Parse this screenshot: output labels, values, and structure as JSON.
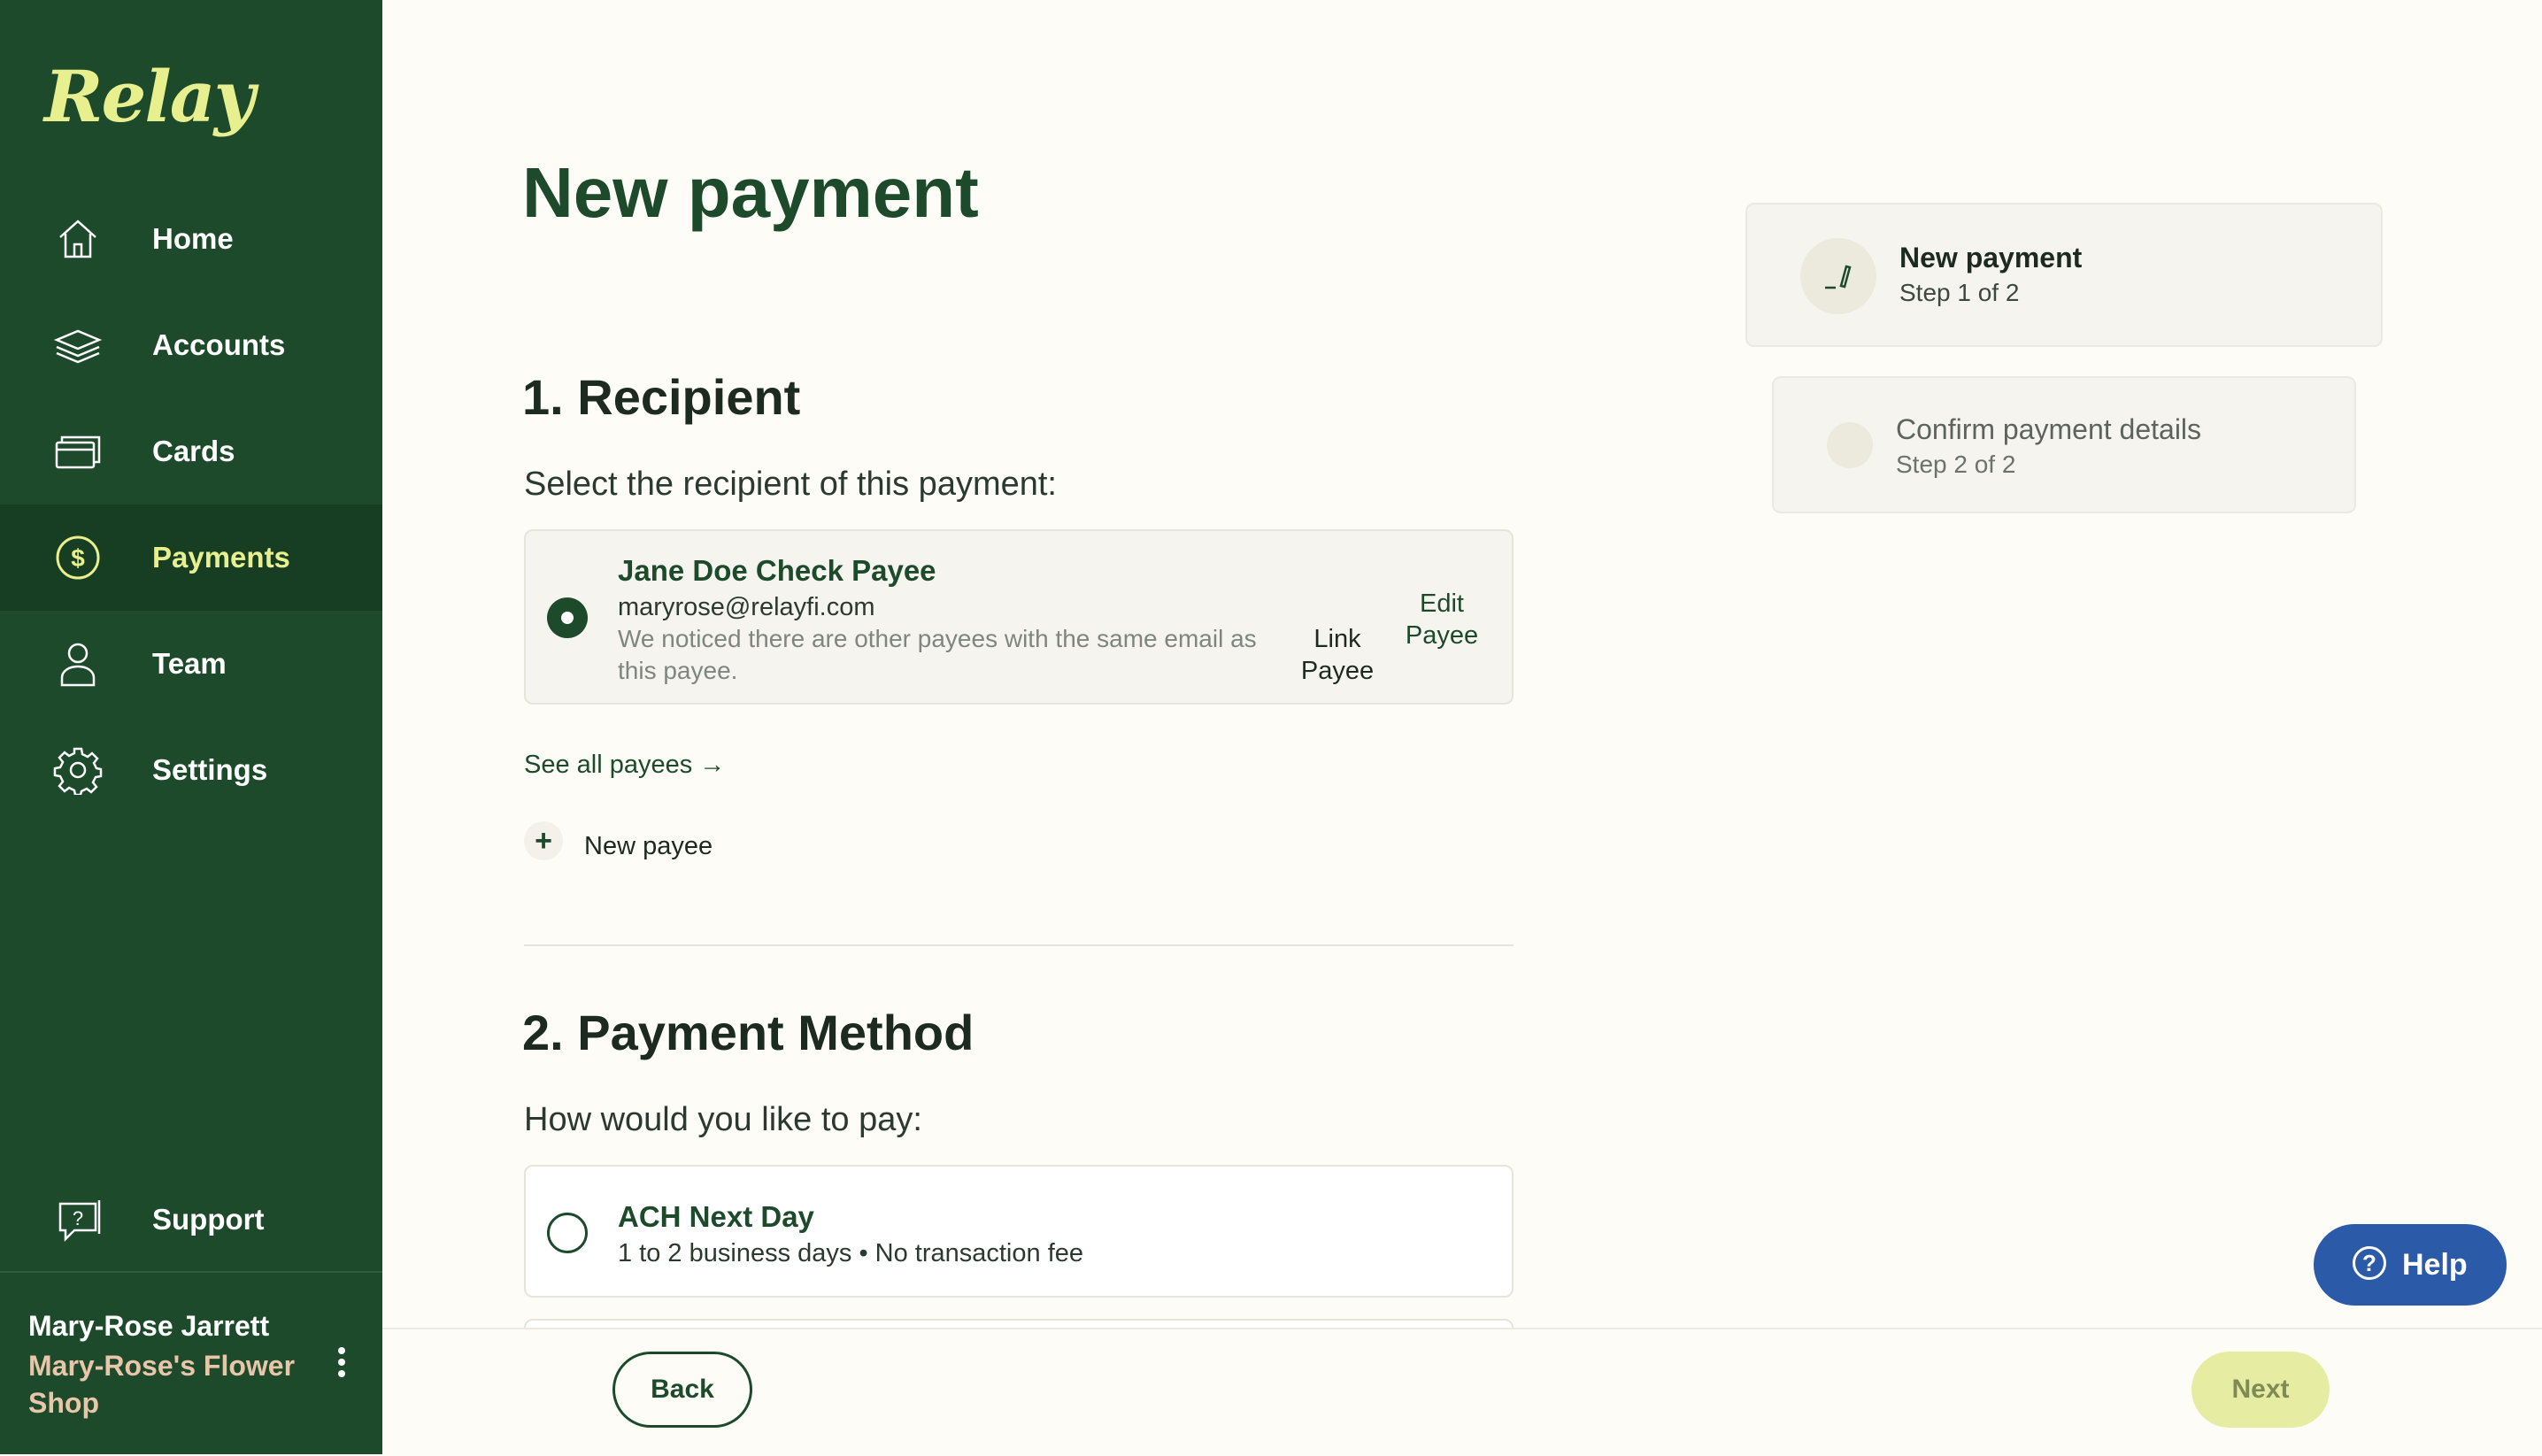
{
  "app": {
    "logo": "Relay"
  },
  "sidebar": {
    "items": [
      {
        "label": "Home",
        "icon": "home-icon"
      },
      {
        "label": "Accounts",
        "icon": "layers-icon"
      },
      {
        "label": "Cards",
        "icon": "cards-icon"
      },
      {
        "label": "Payments",
        "icon": "dollar-icon",
        "active": true
      },
      {
        "label": "Team",
        "icon": "user-icon"
      },
      {
        "label": "Settings",
        "icon": "gear-icon"
      }
    ],
    "support": {
      "label": "Support",
      "icon": "support-icon"
    },
    "user": {
      "name": "Mary-Rose Jarrett",
      "company": "Mary-Rose's Flower Shop"
    }
  },
  "main": {
    "title": "New payment",
    "recipient": {
      "heading": "1. Recipient",
      "prompt": "Select the recipient of this payment:",
      "payee": {
        "name": "Jane Doe Check Payee",
        "email": "maryrose@relayfi.com",
        "note": "We noticed there are other payees with the same email as this payee.",
        "link_action_line1": "Link",
        "link_action_line2": "Payee",
        "edit_action_line1": "Edit",
        "edit_action_line2": "Payee"
      },
      "see_all": "See all payees →",
      "new_payee": "New payee"
    },
    "method": {
      "heading": "2. Payment Method",
      "prompt": "How would you like to pay:",
      "options": [
        {
          "name": "ACH Next Day",
          "desc": "1 to 2 business days • No transaction fee"
        }
      ]
    }
  },
  "steps": [
    {
      "title": "New payment",
      "sub": "Step 1 of 2",
      "icon": "pencil-icon"
    },
    {
      "title": "Confirm payment details",
      "sub": "Step 2 of 2"
    }
  ],
  "footer": {
    "back": "Back",
    "next": "Next",
    "help": "Help"
  },
  "colors": {
    "sidebar": "#1c4a2a",
    "accent": "#e8ef8f",
    "help": "#2b5aa8"
  }
}
